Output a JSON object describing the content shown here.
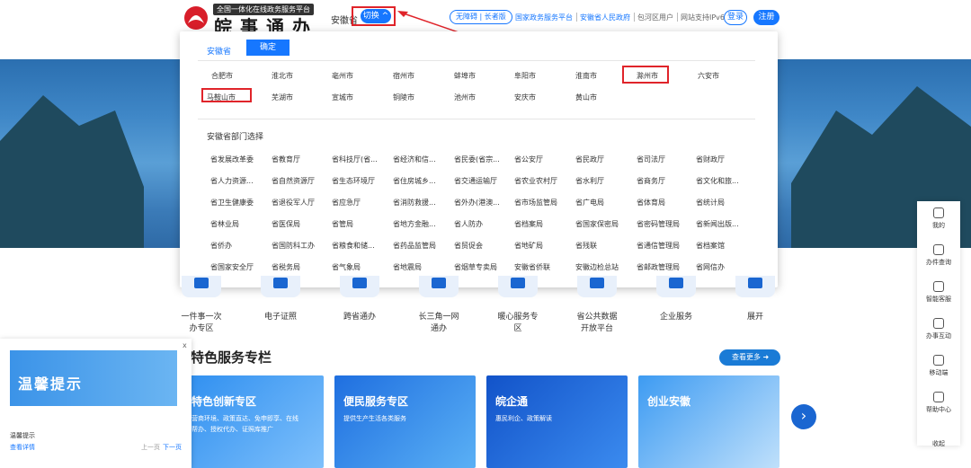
{
  "header": {
    "logo_subtitle": "全国一体化在线政务服务平台",
    "logo_title": "皖事通办",
    "region": "安徽省",
    "switch_label": "切换",
    "access_pill": "无障碍 | 长者版",
    "link_national": "国家政务服务平台",
    "link_province": "安徽省人民政府",
    "link_baohe": "包河区用户",
    "ipv6": "网站支持IPv6",
    "login": "登录",
    "register": "注册"
  },
  "dropdown": {
    "province_tab": "安徽省",
    "confirm": "确定",
    "cities": [
      "合肥市",
      "淮北市",
      "亳州市",
      "宿州市",
      "蚌埠市",
      "阜阳市",
      "淮南市",
      "滁州市",
      "六安市",
      "马鞍山市",
      "芜湖市",
      "宣城市",
      "铜陵市",
      "池州市",
      "安庆市",
      "黄山市"
    ],
    "dept_section_title": "安徽省部门选择",
    "departments": [
      [
        "省发展改革委",
        "省教育厅",
        "省科技厅(省...",
        "省经济和信...",
        "省民委(省宗...",
        "省公安厅",
        "省民政厅",
        "省司法厅",
        "省财政厅"
      ],
      [
        "省人力资源...",
        "省自然资源厅",
        "省生态环境厅",
        "省住房城乡...",
        "省交通运输厅",
        "省农业农村厅",
        "省水利厅",
        "省商务厅",
        "省文化和旅..."
      ],
      [
        "省卫生健康委",
        "省退役军人厅",
        "省应急厅",
        "省消防救援...",
        "省外办(港澳...",
        "省市场监管局",
        "省广电局",
        "省体育局",
        "省统计局"
      ],
      [
        "省林业局",
        "省医保局",
        "省管局",
        "省地方金融...",
        "省人防办",
        "省档案局",
        "省国家保密局",
        "省密码管理局",
        "省新闻出版..."
      ],
      [
        "省侨办",
        "省国防科工办",
        "省粮食和储...",
        "省药品监管局",
        "省贸促会",
        "省地矿局",
        "省残联",
        "省通信管理局",
        "省档案馆"
      ],
      [
        "省国家安全厅",
        "省税务局",
        "省气象局",
        "省地震局",
        "省烟草专卖局",
        "安徽省侨联",
        "安徽边检总站",
        "省邮政管理局",
        "省网信办"
      ]
    ]
  },
  "services": [
    [
      "一件事一次",
      "办专区"
    ],
    [
      "电子证照"
    ],
    [
      "跨省通办"
    ],
    [
      "长三角一网",
      "通办"
    ],
    [
      "暖心服务专",
      "区"
    ],
    [
      "省公共数据",
      "开放平台"
    ],
    [
      "企业服务"
    ],
    [
      "展开"
    ]
  ],
  "section": {
    "heading": "特色服务专栏",
    "more": "查看更多"
  },
  "cards": [
    {
      "title": "特色创新专区",
      "desc": "营商环境、政策直达、免申即享、在线帮办、授权代办、证照库推广"
    },
    {
      "title": "便民服务专区",
      "desc": "提供生产生活各类服务"
    },
    {
      "title": "皖企通",
      "desc": "惠民利企、政策解读"
    },
    {
      "title": "创业安徽",
      "desc": ""
    }
  ],
  "popup": {
    "image_text": "温馨提示",
    "title": "温馨提示",
    "detail": "查看详情",
    "prev": "上一页",
    "next": "下一页",
    "close": "x"
  },
  "rightbar": [
    "我的",
    "办件查询",
    "智能客服",
    "办事互动",
    "移动端",
    "帮助中心",
    "收起"
  ],
  "colors": {
    "primary": "#1677ff",
    "highlight": "#e0242a"
  }
}
